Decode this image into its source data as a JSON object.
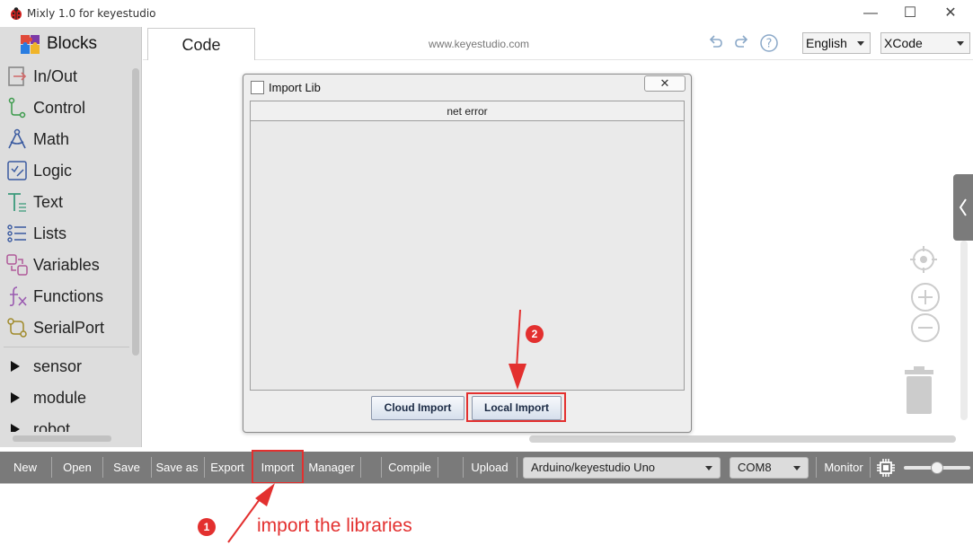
{
  "window": {
    "title": "Mixly 1.0 for keyestudio",
    "minimize": "—",
    "maximize": "☐",
    "close": "✕"
  },
  "sidebar": {
    "header": "Blocks",
    "categories": [
      {
        "label": "In/Out",
        "icon": "in-out-icon"
      },
      {
        "label": "Control",
        "icon": "control-icon"
      },
      {
        "label": "Math",
        "icon": "math-icon"
      },
      {
        "label": "Logic",
        "icon": "logic-icon"
      },
      {
        "label": "Text",
        "icon": "text-icon"
      },
      {
        "label": "Lists",
        "icon": "lists-icon"
      },
      {
        "label": "Variables",
        "icon": "variables-icon"
      },
      {
        "label": "Functions",
        "icon": "functions-icon"
      },
      {
        "label": "SerialPort",
        "icon": "serialport-icon"
      }
    ],
    "groups": [
      {
        "label": "sensor"
      },
      {
        "label": "module"
      },
      {
        "label": "robot"
      }
    ]
  },
  "tabbar": {
    "tab_code": "Code",
    "site": "www.keyestudio.com",
    "language": "English",
    "theme": "XCode"
  },
  "dialog": {
    "title": "Import Lib",
    "close": "✕",
    "list_header": "net error",
    "cloud_import": "Cloud Import",
    "local_import": "Local Import"
  },
  "toolbar": {
    "new": "New",
    "open": "Open",
    "save": "Save",
    "save_as": "Save as",
    "export": "Export",
    "import": "Import",
    "manager": "Manager",
    "compile": "Compile",
    "upload": "Upload",
    "board": "Arduino/keyestudio Uno",
    "port": "COM8",
    "monitor": "Monitor"
  },
  "annotations": {
    "step1_badge": "1",
    "step1_text": "import the libraries",
    "step2_badge": "2",
    "color": "#e3302f"
  }
}
